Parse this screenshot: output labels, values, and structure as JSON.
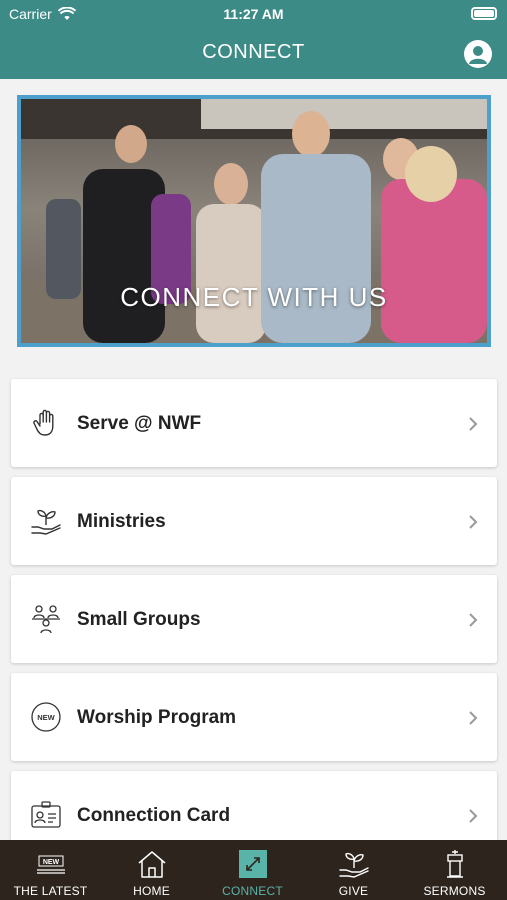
{
  "status_bar": {
    "carrier": "Carrier",
    "time": "11:27 AM"
  },
  "header": {
    "title": "CONNECT"
  },
  "banner": {
    "text": "CONNECT WITH US"
  },
  "menu": [
    {
      "label": "Serve @ NWF",
      "icon": "hand-icon"
    },
    {
      "label": "Ministries",
      "icon": "plant-hand-icon"
    },
    {
      "label": "Small Groups",
      "icon": "people-group-icon"
    },
    {
      "label": "Worship Program",
      "icon": "new-badge-icon",
      "badge": "NEW"
    },
    {
      "label": "Connection Card",
      "icon": "id-card-icon"
    }
  ],
  "tabs": [
    {
      "label": "THE LATEST",
      "icon": "new-sign-icon",
      "badge": "NEW"
    },
    {
      "label": "HOME",
      "icon": "home-icon"
    },
    {
      "label": "CONNECT",
      "icon": "connect-icon",
      "active": true
    },
    {
      "label": "GIVE",
      "icon": "give-icon"
    },
    {
      "label": "SERMONS",
      "icon": "pulpit-icon"
    }
  ],
  "colors": {
    "header": "#3d8b87",
    "tabbar": "#2d241d",
    "active_tab": "#59b3a8",
    "banner_border": "#4da0cc"
  }
}
